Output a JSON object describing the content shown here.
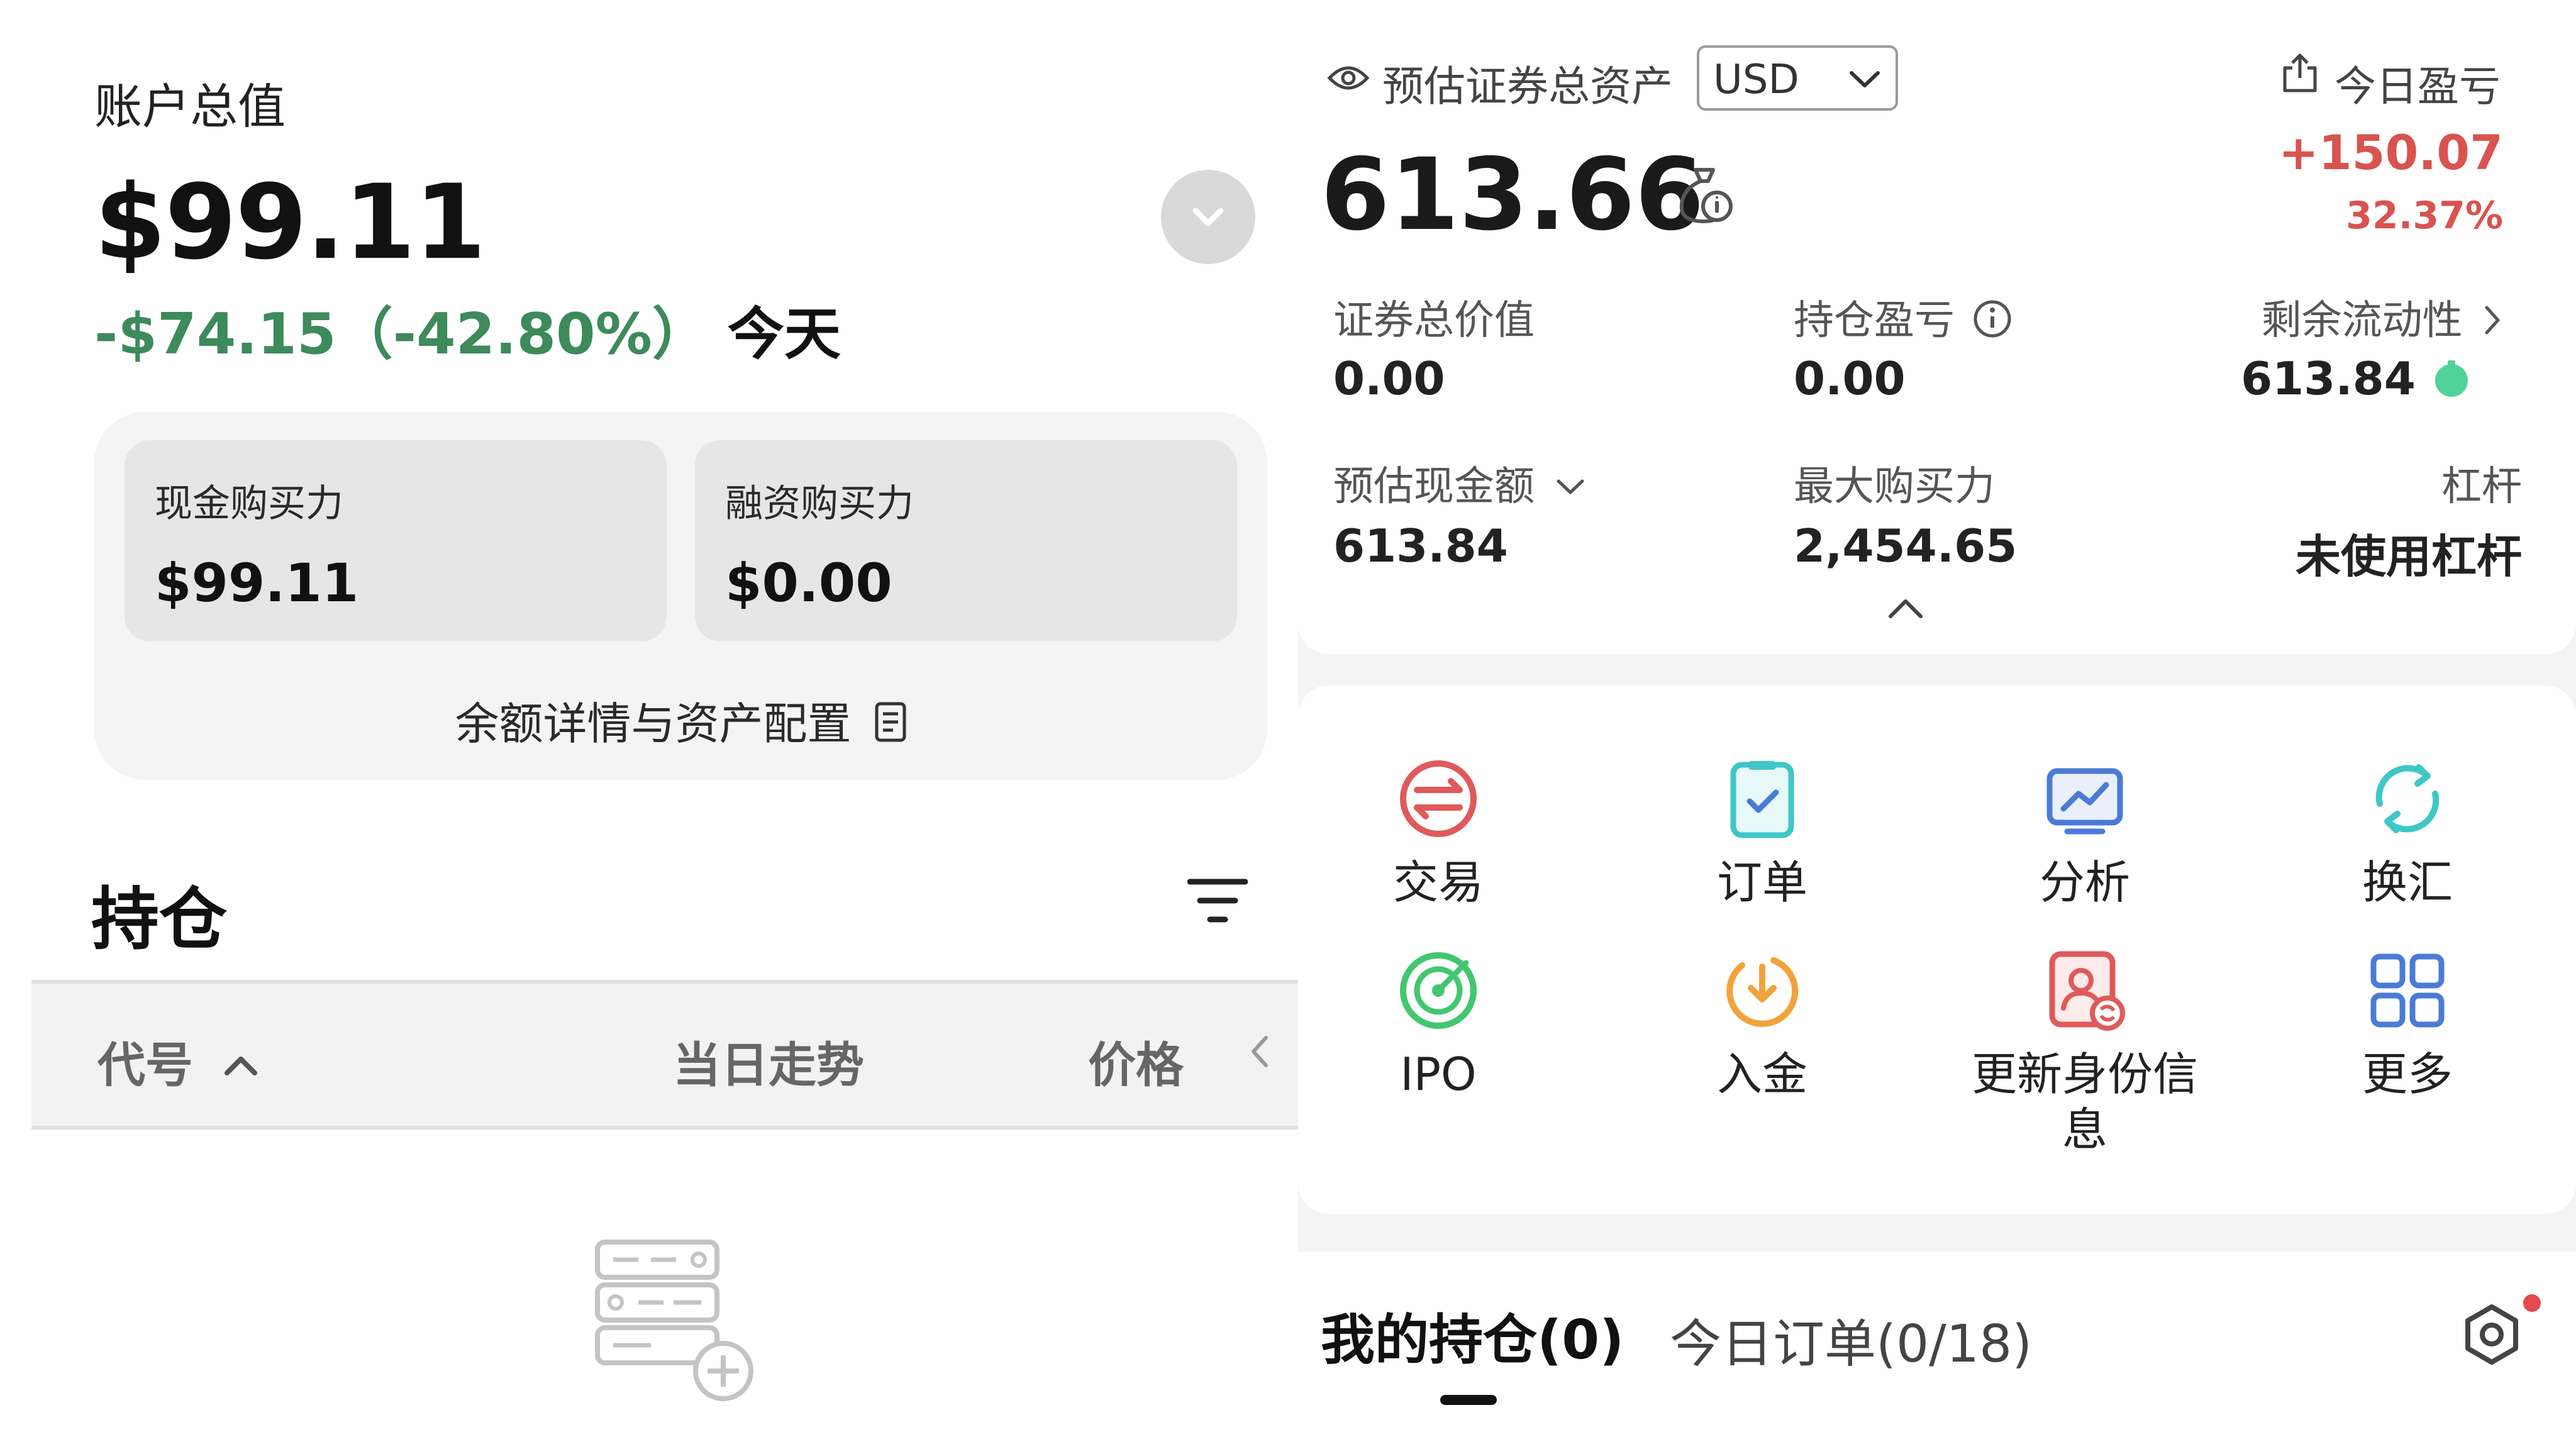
{
  "left": {
    "account_title": "账户总值",
    "account_value": "$99.11",
    "change_amount": "-$74.15（-42.80%）",
    "change_period": "今天",
    "cash_bp_label": "现金购买力",
    "cash_bp_value": "$99.11",
    "margin_bp_label": "融资购买力",
    "margin_bp_value": "$0.00",
    "balance_detail": "余额详情与资产配置",
    "positions_title": "持仓",
    "columns": {
      "code": "代号",
      "trend": "当日走势",
      "price": "价格"
    }
  },
  "right": {
    "est_assets_label": "预估证券总资产",
    "currency": "USD",
    "today_pnl_label": "今日盈亏",
    "today_pnl_value": "+150.07",
    "today_pnl_pct": "32.37%",
    "total_value": "613.66",
    "metrics": {
      "securities_value_label": "证券总价值",
      "securities_value": "0.00",
      "position_pnl_label": "持仓盈亏",
      "position_pnl": "0.00",
      "remaining_liquidity_label": "剩余流动性",
      "remaining_liquidity": "613.84",
      "est_cash_label": "预估现金额",
      "est_cash": "613.84",
      "max_bp_label": "最大购买力",
      "max_bp": "2,454.65",
      "leverage_label": "杠杆",
      "leverage": "未使用杠杆"
    },
    "actions": [
      {
        "label": "交易",
        "icon": "trade-icon"
      },
      {
        "label": "订单",
        "icon": "order-icon"
      },
      {
        "label": "分析",
        "icon": "analysis-icon"
      },
      {
        "label": "换汇",
        "icon": "exchange-icon"
      },
      {
        "label": "IPO",
        "icon": "ipo-icon"
      },
      {
        "label": "入金",
        "icon": "deposit-icon"
      },
      {
        "label": "更新身份信息",
        "icon": "update-identity-icon"
      },
      {
        "label": "更多",
        "icon": "more-icon"
      }
    ],
    "tabs": {
      "my_positions": "我的持仓(0)",
      "today_orders": "今日订单(0/18)"
    }
  },
  "colors": {
    "negative_green": "#3d8a5a",
    "positive_red": "#d9534f",
    "liquidity_dot": "#4fd39a",
    "action_red": "#e05a5a",
    "action_blue": "#4a7bd6",
    "action_cyan": "#3fc7c7",
    "action_green": "#42c76f",
    "action_orange": "#f2a23a"
  }
}
